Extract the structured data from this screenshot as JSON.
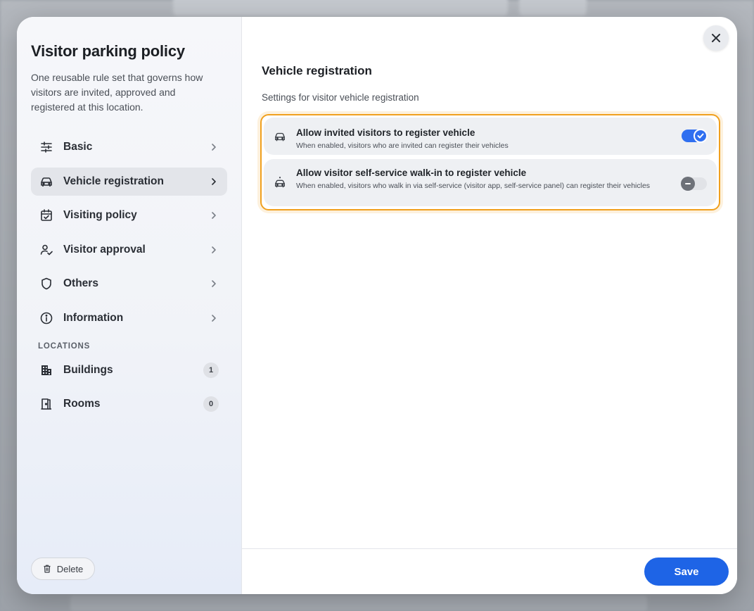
{
  "dialog": {
    "title": "Visitor parking policy",
    "description": "One reusable rule set that governs how visitors are invited, approved and registered at this location."
  },
  "nav": {
    "items": [
      {
        "label": "Basic",
        "icon": "sliders-icon",
        "active": false
      },
      {
        "label": "Vehicle registration",
        "icon": "car-icon",
        "active": true
      },
      {
        "label": "Visiting policy",
        "icon": "calendar-check-icon",
        "active": false
      },
      {
        "label": "Visitor approval",
        "icon": "user-check-icon",
        "active": false
      },
      {
        "label": "Others",
        "icon": "shield-icon",
        "active": false
      },
      {
        "label": "Information",
        "icon": "info-icon",
        "active": false
      }
    ],
    "locations_heading": "LOCATIONS",
    "locations": [
      {
        "label": "Buildings",
        "icon": "building-icon",
        "count": "1"
      },
      {
        "label": "Rooms",
        "icon": "door-icon",
        "count": "0"
      }
    ],
    "delete_label": "Delete"
  },
  "main": {
    "title": "Vehicle registration",
    "subtitle": "Settings for visitor vehicle registration",
    "settings": [
      {
        "title": "Allow invited visitors to register vehicle",
        "description": "When enabled, visitors who are invited can register their vehicles",
        "enabled": true,
        "icon": "car-icon"
      },
      {
        "title": "Allow visitor self-service walk-in to register vehicle",
        "description": "When enabled, visitors who walk in via self-service (visitor app, self-service panel) can register their vehicles",
        "enabled": false,
        "icon": "walk-in-car-icon"
      }
    ],
    "save_label": "Save"
  },
  "colors": {
    "accent": "#1e64e6",
    "highlight_border": "#f0a01e",
    "toggle_on": "#2f6ff0"
  }
}
